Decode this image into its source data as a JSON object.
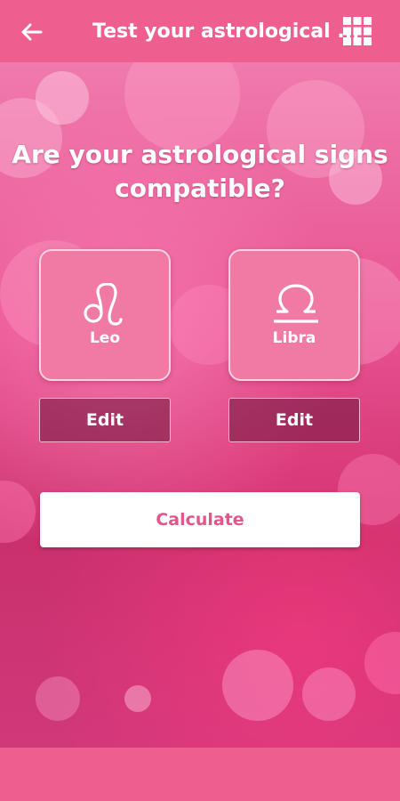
{
  "app_bar": {
    "title": "Test your astrological ...",
    "back_icon": "arrow-left-icon",
    "menu_icon": "grid-icon"
  },
  "main": {
    "headline_line1": "Are your astrological signs",
    "headline_line2": "compatible?",
    "signs": [
      {
        "name": "Leo",
        "icon": "leo-icon",
        "edit_label": "Edit"
      },
      {
        "name": "Libra",
        "icon": "libra-icon",
        "edit_label": "Edit"
      }
    ],
    "calculate_label": "Calculate"
  },
  "colors": {
    "bar": "#ee5f8f",
    "card": "#f07aa3",
    "accent_text": "#e2578a",
    "text": "#ffffff"
  }
}
